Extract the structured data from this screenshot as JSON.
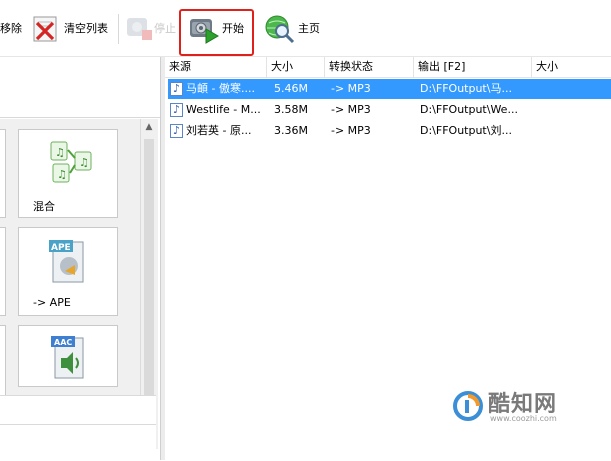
{
  "toolbar": {
    "remove_label": "移除",
    "clear_label": "清空列表",
    "stop_label": "停止",
    "start_label": "开始",
    "home_label": "主页",
    "colors": {
      "highlight": "#e0201b"
    }
  },
  "left_panel": {
    "tiles": [
      {
        "label": "混合",
        "icon": "mix-audio-icon"
      },
      {
        "label": "-> APE",
        "icon": "ape-file-icon"
      },
      {
        "label": "",
        "icon": "aac-file-icon",
        "badge": "AAC"
      }
    ],
    "ape_badge": "APE"
  },
  "file_list": {
    "columns": [
      "来源",
      "大小",
      "转换状态",
      "输出 [F2]",
      "大小"
    ],
    "rows": [
      {
        "source": "马頔 - 傲寒....",
        "size": "5.46M",
        "status": "-> MP3",
        "output": "D:\\FFOutput\\马...",
        "selected": true
      },
      {
        "source": "Westlife - M...",
        "size": "3.58M",
        "status": "-> MP3",
        "output": "D:\\FFOutput\\We...",
        "selected": false
      },
      {
        "source": "刘若英 - 原...",
        "size": "3.36M",
        "status": "-> MP3",
        "output": "D:\\FFOutput\\刘...",
        "selected": false
      }
    ],
    "colors": {
      "selection": "#3399ff"
    }
  },
  "watermark": {
    "text": "酷知网",
    "url": "www.coozhi.com"
  }
}
